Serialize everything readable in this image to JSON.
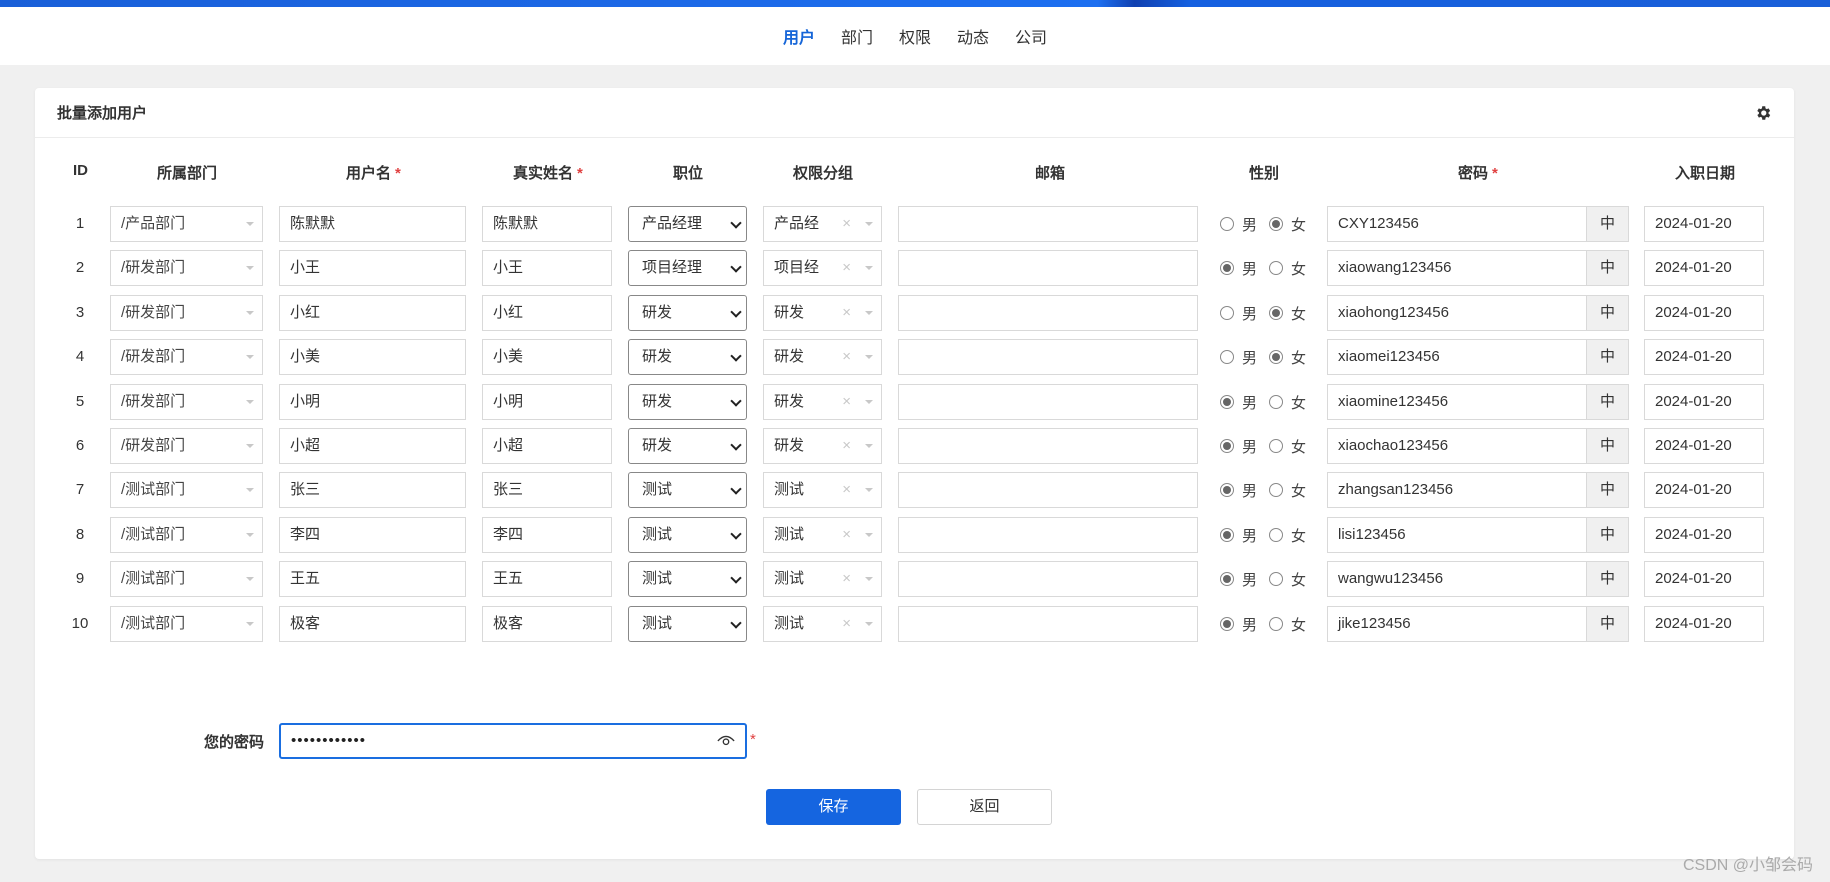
{
  "nav": {
    "items": [
      "用户",
      "部门",
      "权限",
      "动态",
      "公司"
    ],
    "active": 0
  },
  "card": {
    "title": "批量添加用户",
    "settings_icon": "gear-icon"
  },
  "columns": {
    "id": "ID",
    "dept": "所属部门",
    "username": "用户名",
    "realname": "真实姓名",
    "position": "职位",
    "group": "权限分组",
    "email": "邮箱",
    "gender": "性别",
    "password": "密码",
    "hire_date": "入职日期",
    "required_mark": "*"
  },
  "gender_labels": {
    "male": "男",
    "female": "女"
  },
  "password_addon": "中",
  "rows": [
    {
      "id": "1",
      "dept": "/产品部门",
      "username": "陈默默",
      "realname": "陈默默",
      "position": "产品经理",
      "group": "产品经",
      "email": "",
      "gender": "female",
      "password": "CXY123456",
      "hire_date": "2024-01-20"
    },
    {
      "id": "2",
      "dept": "/研发部门",
      "username": "小王",
      "realname": "小王",
      "position": "项目经理",
      "group": "项目经",
      "email": "",
      "gender": "male",
      "password": "xiaowang123456",
      "hire_date": "2024-01-20"
    },
    {
      "id": "3",
      "dept": "/研发部门",
      "username": "小红",
      "realname": "小红",
      "position": "研发",
      "group": "研发",
      "email": "",
      "gender": "female",
      "password": "xiaohong123456",
      "hire_date": "2024-01-20"
    },
    {
      "id": "4",
      "dept": "/研发部门",
      "username": "小美",
      "realname": "小美",
      "position": "研发",
      "group": "研发",
      "email": "",
      "gender": "female",
      "password": "xiaomei123456",
      "hire_date": "2024-01-20"
    },
    {
      "id": "5",
      "dept": "/研发部门",
      "username": "小明",
      "realname": "小明",
      "position": "研发",
      "group": "研发",
      "email": "",
      "gender": "male",
      "password": "xiaomine123456",
      "hire_date": "2024-01-20"
    },
    {
      "id": "6",
      "dept": "/研发部门",
      "username": "小超",
      "realname": "小超",
      "position": "研发",
      "group": "研发",
      "email": "",
      "gender": "male",
      "password": "xiaochao123456",
      "hire_date": "2024-01-20"
    },
    {
      "id": "7",
      "dept": "/测试部门",
      "username": "张三",
      "realname": "张三",
      "position": "测试",
      "group": "测试",
      "email": "",
      "gender": "male",
      "password": "zhangsan123456",
      "hire_date": "2024-01-20"
    },
    {
      "id": "8",
      "dept": "/测试部门",
      "username": "李四",
      "realname": "李四",
      "position": "测试",
      "group": "测试",
      "email": "",
      "gender": "male",
      "password": "lisi123456",
      "hire_date": "2024-01-20"
    },
    {
      "id": "9",
      "dept": "/测试部门",
      "username": "王五",
      "realname": "王五",
      "position": "测试",
      "group": "测试",
      "email": "",
      "gender": "male",
      "password": "wangwu123456",
      "hire_date": "2024-01-20"
    },
    {
      "id": "10",
      "dept": "/测试部门",
      "username": "极客",
      "realname": "极客",
      "position": "测试",
      "group": "测试",
      "email": "",
      "gender": "male",
      "password": "jike123456",
      "hire_date": "2024-01-20"
    }
  ],
  "your_password": {
    "label": "您的密码",
    "value": "••••••••••••",
    "required_mark": "*",
    "eye_icon": "eye-icon"
  },
  "buttons": {
    "save": "保存",
    "back": "返回"
  },
  "watermark": "CSDN @小邹会码",
  "colors": {
    "primary": "#1565e0",
    "required": "#e04040",
    "active_nav": "#1565d8"
  }
}
